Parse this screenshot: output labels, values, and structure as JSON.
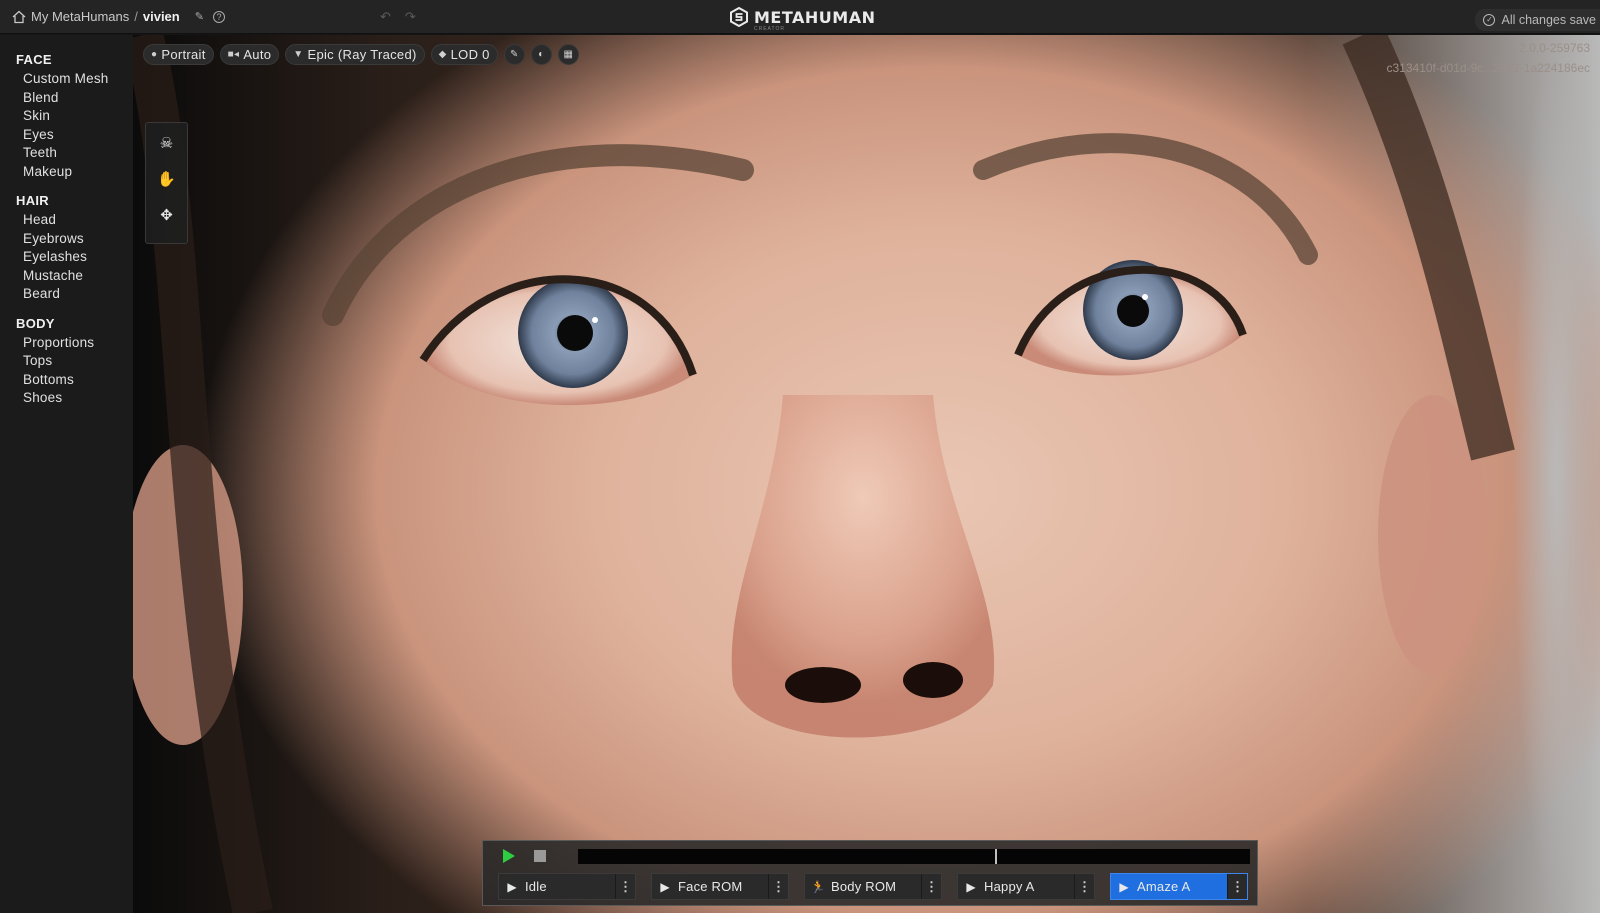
{
  "topbar": {
    "breadcrumb_root": "My MetaHumans",
    "separator": "/",
    "current": "vivien",
    "logo_text": "METAHUMAN",
    "logo_sub": "CREATOR",
    "status": "All changes save",
    "icons": [
      "home-icon",
      "edit-icon",
      "help-icon",
      "undo-icon",
      "redo-icon",
      "check-circle-icon"
    ]
  },
  "sidebar": {
    "sections": [
      {
        "title": "FACE",
        "items": [
          "Custom Mesh",
          "Blend",
          "Skin",
          "Eyes",
          "Teeth",
          "Makeup"
        ]
      },
      {
        "title": "HAIR",
        "items": [
          "Head",
          "Eyebrows",
          "Eyelashes",
          "Mustache",
          "Beard"
        ]
      },
      {
        "title": "BODY",
        "items": [
          "Proportions",
          "Tops",
          "Bottoms",
          "Shoes"
        ]
      }
    ]
  },
  "viewport": {
    "version_line1": "2.0.0-259763",
    "version_line2": "c313410f-d01d-9c...2022-1a224186ec",
    "toolbar": {
      "camera": "Portrait",
      "lighting": "Auto",
      "quality": "Epic (Ray Traced)",
      "lod": "LOD 0"
    },
    "tools": [
      "skull-icon",
      "hand-icon",
      "move-icon"
    ]
  },
  "player": {
    "progress": 0.62,
    "animations": [
      {
        "label": "Idle",
        "icon": "play-circle-icon",
        "active": false
      },
      {
        "label": "Face ROM",
        "icon": "play-circle-icon",
        "active": false
      },
      {
        "label": "Body ROM",
        "icon": "running-icon",
        "active": false
      },
      {
        "label": "Happy A",
        "icon": "play-circle-icon",
        "active": false
      },
      {
        "label": "Amaze A",
        "icon": "play-circle-icon",
        "active": true
      }
    ]
  },
  "colors": {
    "accent": "#1f6fe0",
    "play": "#2ecc40",
    "iris": "#7d8ea8"
  }
}
